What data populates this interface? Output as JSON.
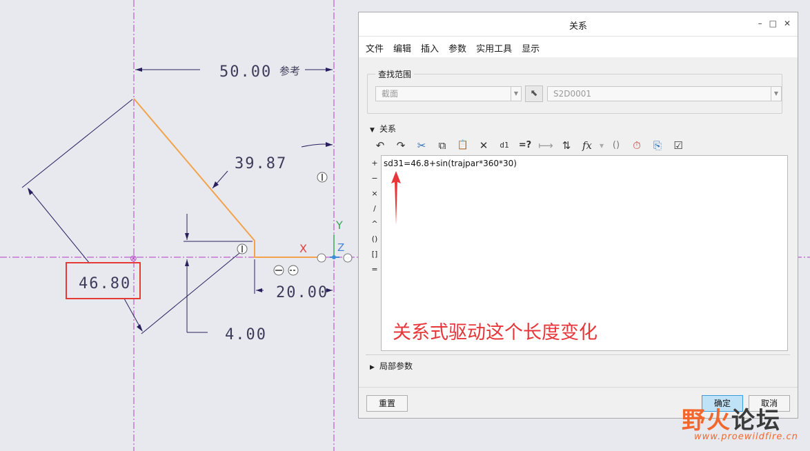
{
  "sketch": {
    "dim_top": "50.00",
    "dim_top_ref": "参考",
    "dim_diag": "39.87",
    "dim_length": "46.80",
    "dim_horizontal": "20.00",
    "dim_vertical": "4.00",
    "axis_x": "X",
    "axis_y": "Y",
    "axis_z": "Z"
  },
  "dialog": {
    "title": "关系",
    "window_controls": [
      "–",
      "□",
      "✕"
    ],
    "menu": [
      "文件",
      "编辑",
      "插入",
      "参数",
      "实用工具",
      "显示"
    ],
    "find_scope": {
      "label": "查找范围",
      "type_value": "截面",
      "object_value": "S2D0001"
    },
    "relations_section": "关系",
    "toolbar_icons": [
      "undo-icon",
      "redo-icon",
      "cut-icon",
      "copy-icon",
      "paste-icon",
      "delete-icon",
      "switch-dimensions-icon",
      "evaluate-icon",
      "show-dimension-icon",
      "sort-icon",
      "function-icon",
      "parentheses-icon",
      "execute-icon",
      "insert-from-file-icon",
      "verify-icon"
    ],
    "toolbar_glyphs": {
      "undo": "↶",
      "redo": "↷",
      "cut": "✂",
      "copy": "⧉",
      "paste": "📋",
      "delete": "✕",
      "switch": "d1",
      "evaluate": "=?",
      "show_dim": "⟼",
      "sort": "⇅",
      "function": "fx",
      "parens": "()",
      "execute": "⏱",
      "insert": "⎘",
      "verify": "☑"
    },
    "operators": [
      "+",
      "−",
      "×",
      "/",
      "^",
      "()",
      "[]",
      "="
    ],
    "relation_text": "sd31=46.8+sin(trajpar*360*30)",
    "annotation": "关系式驱动这个长度变化",
    "local_params": "局部参数",
    "reset_button": "重置",
    "ok_button": "确定",
    "cancel_button": "取消"
  },
  "watermark": {
    "text_part1": "野",
    "text_part2": "火",
    "text_part3": "论坛",
    "url": "www.proewildfire.cn"
  },
  "colors": {
    "sketch_line": "#f2a24a",
    "dim_line": "#2a1f5e",
    "centerline": "#b43cc8",
    "highlight_box": "#e53935",
    "annotation": "#e8353a",
    "ok_button": "#bfe2f7"
  }
}
